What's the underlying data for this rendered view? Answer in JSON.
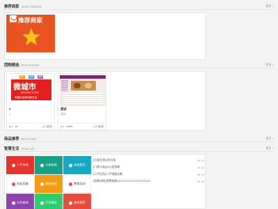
{
  "recommend": {
    "title": "推荐商家",
    "subtitle": "Board Selection",
    "more": "更多 >",
    "card_name": "推荐商家",
    "colors": {
      "bg": "#e8531f",
      "star": "#f7c21a"
    }
  },
  "group": {
    "title": "团购精选",
    "subtitle": "Best Groupon",
    "more": "更多 >",
    "items": [
      {
        "image_text": "微城市",
        "image_domain": "0812GO.COM",
        "image_slogan": "掌握买卖移动新生活",
        "image_tags": [
          "热门",
          "最新",
          "推荐"
        ],
        "title": "1",
        "sub": "1",
        "price": "¥ 1",
        "orig": "¥1",
        "joined_count": "1",
        "joined_suffix": "人参团"
      },
      {
        "title": "测试",
        "sub": "测试",
        "price": "¥ 1",
        "orig": "¥100",
        "joined_count": "2",
        "joined_suffix": "人参团"
      }
    ]
  },
  "goods": {
    "title": "商品推荐",
    "subtitle": "Best Goods",
    "more": "更多 >"
  },
  "life": {
    "title": "智慧生活",
    "subtitle": "Smart Life",
    "more": "更多 >",
    "tiles": [
      {
        "label": "二手市场",
        "color": "#e7332e",
        "icon": "tag-icon"
      },
      {
        "label": "头条新闻",
        "color": "#16a085",
        "icon": "news-icon"
      },
      {
        "label": "本地黄页",
        "color": "#16a8c4",
        "icon": "book-icon"
      },
      {
        "label": "交友征婚",
        "color": "#ffffff",
        "icon": "heart-icon"
      },
      {
        "label": "便民查询",
        "color": "#f39c12",
        "icon": "search-icon"
      },
      {
        "label": "教育培训",
        "color": "#ffffff",
        "icon": "education-icon"
      },
      {
        "label": "公交查询",
        "color": "#8e44ad",
        "icon": "bus-icon"
      },
      {
        "label": "生活服务",
        "color": "#2ecc71",
        "icon": "service-icon"
      },
      {
        "label": "美食推荐",
        "color": "#e74c3c",
        "icon": "food-icon"
      }
    ],
    "news": [
      {
        "cat": "[分类信息]",
        "text": "3的分类",
        "date": "09-13"
      },
      {
        "cat": "[门票卡券]",
        "text": "办公室招聘",
        "date": "09-02"
      },
      {
        "cat": "[二手旧货]",
        "text": "二手电脑出售",
        "date": "08-29"
      },
      {
        "cat": "[招聘求职]",
        "text": "招聘销售XXXXXXXXXXXXXXXXXX",
        "date": "08-26"
      }
    ]
  }
}
